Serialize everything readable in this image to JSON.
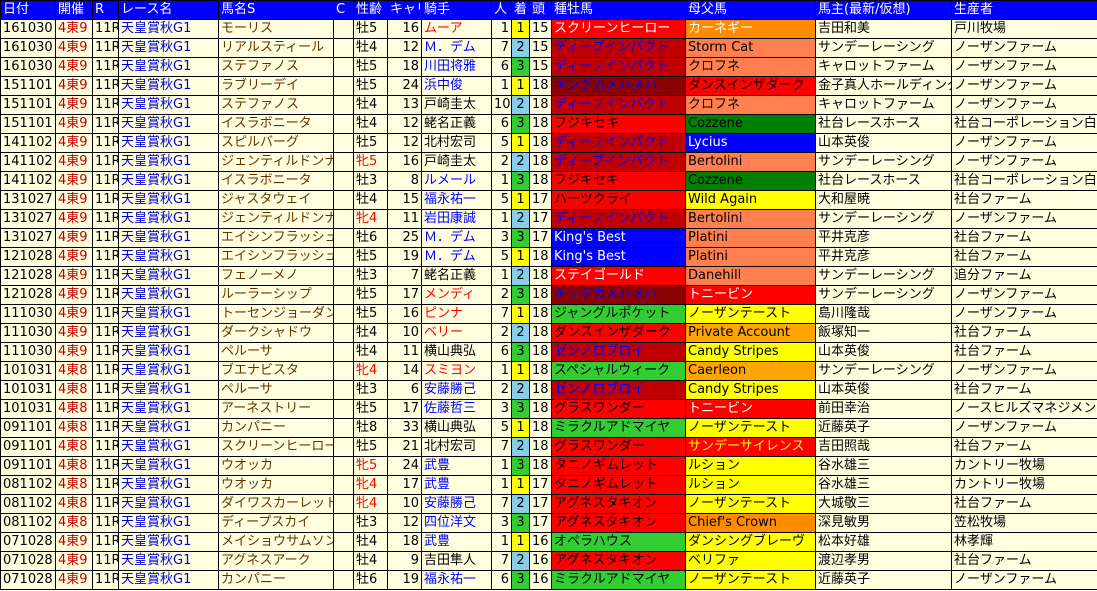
{
  "headers": [
    "日付",
    "開催",
    "R",
    "レース名",
    "馬名S",
    "C",
    "性齢",
    "キャリア",
    "騎手",
    "人",
    "着",
    "頭",
    "種牡馬",
    "母父馬",
    "馬主(最新/仮想)",
    "生産者"
  ],
  "rows": [
    {
      "date": "161030",
      "venue": "4東9",
      "r": "11R",
      "race": "天皇賞秋G1",
      "horse": "モーリス",
      "c": "",
      "sexage": "牡5",
      "sex_red": false,
      "career": "16",
      "jockey": "ムーア",
      "jockey_color": "#ff0000",
      "pop": "1",
      "fin": "1",
      "heads": "15",
      "sire": "スクリーンヒーロー",
      "sire_bg": "#ff0000",
      "sire_fg": "#ffffff",
      "dam": "カーネギー",
      "dam_bg": "#ff8c00",
      "dam_fg": "#ffffff",
      "owner": "吉田和美",
      "breeder": "戸川牧場"
    },
    {
      "date": "161030",
      "venue": "4東9",
      "r": "11R",
      "race": "天皇賞秋G1",
      "horse": "リアルスティール",
      "c": "",
      "sexage": "牡4",
      "sex_red": false,
      "career": "12",
      "jockey": "Ｍ．デム",
      "jockey_color": "#0000ff",
      "pop": "7",
      "fin": "2",
      "heads": "15",
      "sire": "ディープインパクト",
      "sire_bg": "#c00000",
      "sire_fg": "#0000ff",
      "dam": "Storm Cat",
      "dam_bg": "#ff7f50",
      "dam_fg": "#000000",
      "owner": "サンデーレーシング",
      "breeder": "ノーザンファーム"
    },
    {
      "date": "161030",
      "venue": "4東9",
      "r": "11R",
      "race": "天皇賞秋G1",
      "horse": "ステファノス",
      "c": "",
      "sexage": "牡5",
      "sex_red": false,
      "career": "18",
      "jockey": "川田将雅",
      "jockey_color": "#0000ff",
      "pop": "6",
      "fin": "3",
      "heads": "15",
      "sire": "ディープインパクト",
      "sire_bg": "#c00000",
      "sire_fg": "#0000ff",
      "dam": "クロフネ",
      "dam_bg": "#ff7f50",
      "dam_fg": "#000000",
      "owner": "キャロットファーム",
      "breeder": "ノーザンファーム"
    },
    {
      "date": "151101",
      "venue": "4東9",
      "r": "11R",
      "race": "天皇賞秋G1",
      "horse": "ラブリーデイ",
      "c": "",
      "sexage": "牡5",
      "sex_red": false,
      "career": "24",
      "jockey": "浜中俊",
      "jockey_color": "#0000ff",
      "pop": "1",
      "fin": "1",
      "heads": "18",
      "sire": "キングカメハメハ",
      "sire_bg": "#8b0000",
      "sire_fg": "#0000ff",
      "dam": "ダンスインザダーク",
      "dam_bg": "#ff0000",
      "dam_fg": "#000000",
      "owner": "金子真人ホールディングス",
      "breeder": "ノーザンファーム"
    },
    {
      "date": "151101",
      "venue": "4東9",
      "r": "11R",
      "race": "天皇賞秋G1",
      "horse": "ステファノス",
      "c": "",
      "sexage": "牡4",
      "sex_red": false,
      "career": "13",
      "jockey": "戸崎圭太",
      "jockey_color": "#000000",
      "pop": "10",
      "fin": "2",
      "heads": "18",
      "sire": "ディープインパクト",
      "sire_bg": "#c00000",
      "sire_fg": "#0000ff",
      "dam": "クロフネ",
      "dam_bg": "#ff7f50",
      "dam_fg": "#000000",
      "owner": "キャロットファーム",
      "breeder": "ノーザンファーム"
    },
    {
      "date": "151101",
      "venue": "4東9",
      "r": "11R",
      "race": "天皇賞秋G1",
      "horse": "イスラボニータ",
      "c": "",
      "sexage": "牡4",
      "sex_red": false,
      "career": "12",
      "jockey": "蛯名正義",
      "jockey_color": "#000000",
      "pop": "6",
      "fin": "3",
      "heads": "18",
      "sire": "フジキセキ",
      "sire_bg": "#ff0000",
      "sire_fg": "#000000",
      "dam": "Cozzene",
      "dam_bg": "#008000",
      "dam_fg": "#000000",
      "owner": "社台レースホース",
      "breeder": "社台コーポレーション白老ファーム"
    },
    {
      "date": "141102",
      "venue": "4東9",
      "r": "11R",
      "race": "天皇賞秋G1",
      "horse": "スピルバーグ",
      "c": "",
      "sexage": "牡5",
      "sex_red": false,
      "career": "12",
      "jockey": "北村宏司",
      "jockey_color": "#000000",
      "pop": "5",
      "fin": "1",
      "heads": "18",
      "sire": "ディープインパクト",
      "sire_bg": "#c00000",
      "sire_fg": "#0000ff",
      "dam": "Lycius",
      "dam_bg": "#0000ff",
      "dam_fg": "#ffffff",
      "owner": "山本英俊",
      "breeder": "ノーザンファーム"
    },
    {
      "date": "141102",
      "venue": "4東9",
      "r": "11R",
      "race": "天皇賞秋G1",
      "horse": "ジェンティルドンナ",
      "c": "",
      "sexage": "牝5",
      "sex_red": true,
      "career": "16",
      "jockey": "戸崎圭太",
      "jockey_color": "#000000",
      "pop": "2",
      "fin": "2",
      "heads": "18",
      "sire": "ディープインパクト",
      "sire_bg": "#c00000",
      "sire_fg": "#0000ff",
      "dam": "Bertolini",
      "dam_bg": "#ff7f50",
      "dam_fg": "#000000",
      "owner": "サンデーレーシング",
      "breeder": "ノーザンファーム"
    },
    {
      "date": "141102",
      "venue": "4東9",
      "r": "11R",
      "race": "天皇賞秋G1",
      "horse": "イスラボニータ",
      "c": "",
      "sexage": "牡3",
      "sex_red": false,
      "career": "8",
      "jockey": "ルメール",
      "jockey_color": "#0000ff",
      "pop": "1",
      "fin": "3",
      "heads": "18",
      "sire": "フジキセキ",
      "sire_bg": "#ff0000",
      "sire_fg": "#000000",
      "dam": "Cozzene",
      "dam_bg": "#008000",
      "dam_fg": "#000000",
      "owner": "社台レースホース",
      "breeder": "社台コーポレーション白老ファーム"
    },
    {
      "date": "131027",
      "venue": "4東9",
      "r": "11R",
      "race": "天皇賞秋G1",
      "horse": "ジャスタウェイ",
      "c": "",
      "sexage": "牡4",
      "sex_red": false,
      "career": "15",
      "jockey": "福永祐一",
      "jockey_color": "#0000ff",
      "pop": "5",
      "fin": "1",
      "heads": "17",
      "sire": "ハーツクライ",
      "sire_bg": "#ff0000",
      "sire_fg": "#000000",
      "dam": "Wild Again",
      "dam_bg": "#ffff00",
      "dam_fg": "#000000",
      "owner": "大和屋暁",
      "breeder": "社台ファーム"
    },
    {
      "date": "131027",
      "venue": "4東9",
      "r": "11R",
      "race": "天皇賞秋G1",
      "horse": "ジェンティルドンナ",
      "c": "",
      "sexage": "牝4",
      "sex_red": true,
      "career": "11",
      "jockey": "岩田康誠",
      "jockey_color": "#0000ff",
      "pop": "1",
      "fin": "2",
      "heads": "17",
      "sire": "ディープインパクト",
      "sire_bg": "#c00000",
      "sire_fg": "#0000ff",
      "dam": "Bertolini",
      "dam_bg": "#ff7f50",
      "dam_fg": "#000000",
      "owner": "サンデーレーシング",
      "breeder": "ノーザンファーム"
    },
    {
      "date": "131027",
      "venue": "4東9",
      "r": "11R",
      "race": "天皇賞秋G1",
      "horse": "エイシンフラッシュ",
      "c": "",
      "sexage": "牡6",
      "sex_red": false,
      "career": "25",
      "jockey": "Ｍ．デム",
      "jockey_color": "#0000ff",
      "pop": "3",
      "fin": "3",
      "heads": "17",
      "sire": "King's Best",
      "sire_bg": "#0000ff",
      "sire_fg": "#ffffff",
      "dam": "Platini",
      "dam_bg": "#ff7f50",
      "dam_fg": "#000000",
      "owner": "平井克彦",
      "breeder": "社台ファーム"
    },
    {
      "date": "121028",
      "venue": "4東9",
      "r": "11R",
      "race": "天皇賞秋G1",
      "horse": "エイシンフラッシュ",
      "c": "",
      "sexage": "牡5",
      "sex_red": false,
      "career": "19",
      "jockey": "Ｍ．デム",
      "jockey_color": "#0000ff",
      "pop": "5",
      "fin": "1",
      "heads": "18",
      "sire": "King's Best",
      "sire_bg": "#0000ff",
      "sire_fg": "#ffffff",
      "dam": "Platini",
      "dam_bg": "#ff7f50",
      "dam_fg": "#000000",
      "owner": "平井克彦",
      "breeder": "社台ファーム"
    },
    {
      "date": "121028",
      "venue": "4東9",
      "r": "11R",
      "race": "天皇賞秋G1",
      "horse": "フェノーメノ",
      "c": "",
      "sexage": "牡3",
      "sex_red": false,
      "career": "7",
      "jockey": "蛯名正義",
      "jockey_color": "#000000",
      "pop": "1",
      "fin": "2",
      "heads": "18",
      "sire": "ステイゴールド",
      "sire_bg": "#ff0000",
      "sire_fg": "#ffffff",
      "dam": "Danehill",
      "dam_bg": "#ff7f50",
      "dam_fg": "#000000",
      "owner": "サンデーレーシング",
      "breeder": "追分ファーム"
    },
    {
      "date": "121028",
      "venue": "4東9",
      "r": "11R",
      "race": "天皇賞秋G1",
      "horse": "ルーラーシップ",
      "c": "",
      "sexage": "牡5",
      "sex_red": false,
      "career": "17",
      "jockey": "メンディ",
      "jockey_color": "#ff0000",
      "pop": "2",
      "fin": "3",
      "heads": "18",
      "sire": "キングカメハメハ",
      "sire_bg": "#8b0000",
      "sire_fg": "#0000ff",
      "dam": "トニービン",
      "dam_bg": "#ff0000",
      "dam_fg": "#ffffff",
      "owner": "サンデーレーシング",
      "breeder": "ノーザンファーム"
    },
    {
      "date": "111030",
      "venue": "4東9",
      "r": "11R",
      "race": "天皇賞秋G1",
      "horse": "トーセンジョーダン",
      "c": "",
      "sexage": "牡5",
      "sex_red": false,
      "career": "16",
      "jockey": "ピンナ",
      "jockey_color": "#ff0000",
      "pop": "7",
      "fin": "1",
      "heads": "18",
      "sire": "ジャングルポケット",
      "sire_bg": "#32cd32",
      "sire_fg": "#000000",
      "dam": "ノーザンテースト",
      "dam_bg": "#ffff00",
      "dam_fg": "#000000",
      "owner": "島川隆哉",
      "breeder": "ノーザンファーム"
    },
    {
      "date": "111030",
      "venue": "4東9",
      "r": "11R",
      "race": "天皇賞秋G1",
      "horse": "ダークシャドウ",
      "c": "",
      "sexage": "牡4",
      "sex_red": false,
      "career": "10",
      "jockey": "ベリー",
      "jockey_color": "#ff0000",
      "pop": "2",
      "fin": "2",
      "heads": "18",
      "sire": "ダンスインザダーク",
      "sire_bg": "#ff0000",
      "sire_fg": "#000000",
      "dam": "Private Account",
      "dam_bg": "#ffa500",
      "dam_fg": "#000000",
      "owner": "飯塚知一",
      "breeder": "社台ファーム"
    },
    {
      "date": "111030",
      "venue": "4東9",
      "r": "11R",
      "race": "天皇賞秋G1",
      "horse": "ペルーサ",
      "c": "",
      "sexage": "牡4",
      "sex_red": false,
      "career": "11",
      "jockey": "横山典弘",
      "jockey_color": "#000000",
      "pop": "6",
      "fin": "3",
      "heads": "18",
      "sire": "ゼンノロブロイ",
      "sire_bg": "#c00000",
      "sire_fg": "#0000ff",
      "dam": "Candy Stripes",
      "dam_bg": "#ffff00",
      "dam_fg": "#000000",
      "owner": "山本英俊",
      "breeder": "社台ファーム"
    },
    {
      "date": "101031",
      "venue": "4東8",
      "r": "11R",
      "race": "天皇賞秋G1",
      "horse": "ブエナビスタ",
      "c": "",
      "sexage": "牝4",
      "sex_red": true,
      "career": "14",
      "jockey": "スミヨン",
      "jockey_color": "#ff0000",
      "pop": "1",
      "fin": "1",
      "heads": "18",
      "sire": "スペシャルウィーク",
      "sire_bg": "#32cd32",
      "sire_fg": "#000000",
      "dam": "Caerleon",
      "dam_bg": "#ffa500",
      "dam_fg": "#000000",
      "owner": "サンデーレーシング",
      "breeder": "ノーザンファーム"
    },
    {
      "date": "101031",
      "venue": "4東8",
      "r": "11R",
      "race": "天皇賞秋G1",
      "horse": "ペルーサ",
      "c": "",
      "sexage": "牡3",
      "sex_red": false,
      "career": "6",
      "jockey": "安藤勝己",
      "jockey_color": "#0000ff",
      "pop": "2",
      "fin": "2",
      "heads": "18",
      "sire": "ゼンノロブロイ",
      "sire_bg": "#c00000",
      "sire_fg": "#0000ff",
      "dam": "Candy Stripes",
      "dam_bg": "#ffff00",
      "dam_fg": "#000000",
      "owner": "山本英俊",
      "breeder": "社台ファーム"
    },
    {
      "date": "101031",
      "venue": "4東8",
      "r": "11R",
      "race": "天皇賞秋G1",
      "horse": "アーネストリー",
      "c": "",
      "sexage": "牡5",
      "sex_red": false,
      "career": "17",
      "jockey": "佐藤哲三",
      "jockey_color": "#0000ff",
      "pop": "3",
      "fin": "3",
      "heads": "18",
      "sire": "グラスワンダー",
      "sire_bg": "#ff0000",
      "sire_fg": "#000000",
      "dam": "トニービン",
      "dam_bg": "#ff0000",
      "dam_fg": "#ffffff",
      "owner": "前田幸治",
      "breeder": "ノースヒルズマネジメント"
    },
    {
      "date": "091101",
      "venue": "4東8",
      "r": "11R",
      "race": "天皇賞秋G1",
      "horse": "カンパニー",
      "c": "",
      "sexage": "牡8",
      "sex_red": false,
      "career": "33",
      "jockey": "横山典弘",
      "jockey_color": "#000000",
      "pop": "5",
      "fin": "1",
      "heads": "18",
      "sire": "ミラクルアドマイヤ",
      "sire_bg": "#32cd32",
      "sire_fg": "#000000",
      "dam": "ノーザンテースト",
      "dam_bg": "#ffff00",
      "dam_fg": "#000000",
      "owner": "近藤英子",
      "breeder": "ノーザンファーム"
    },
    {
      "date": "091101",
      "venue": "4東8",
      "r": "11R",
      "race": "天皇賞秋G1",
      "horse": "スクリーンヒーロー",
      "c": "",
      "sexage": "牡5",
      "sex_red": false,
      "career": "21",
      "jockey": "北村宏司",
      "jockey_color": "#000000",
      "pop": "7",
      "fin": "2",
      "heads": "18",
      "sire": "グラスワンダー",
      "sire_bg": "#ff0000",
      "sire_fg": "#000000",
      "dam": "サンデーサイレンス",
      "dam_bg": "#ff0000",
      "dam_fg": "#ffff00",
      "owner": "吉田照哉",
      "breeder": "社台ファーム"
    },
    {
      "date": "091101",
      "venue": "4東8",
      "r": "11R",
      "race": "天皇賞秋G1",
      "horse": "ウオッカ",
      "c": "",
      "sexage": "牝5",
      "sex_red": true,
      "career": "24",
      "jockey": "武豊",
      "jockey_color": "#0000ff",
      "pop": "1",
      "fin": "3",
      "heads": "18",
      "sire": "タニノギムレット",
      "sire_bg": "#ff0000",
      "sire_fg": "#000000",
      "dam": "ルション",
      "dam_bg": "#ffff00",
      "dam_fg": "#000000",
      "owner": "谷水雄三",
      "breeder": "カントリー牧場"
    },
    {
      "date": "081102",
      "venue": "4東8",
      "r": "11R",
      "race": "天皇賞秋G1",
      "horse": "ウオッカ",
      "c": "",
      "sexage": "牝4",
      "sex_red": true,
      "career": "17",
      "jockey": "武豊",
      "jockey_color": "#0000ff",
      "pop": "1",
      "fin": "1",
      "heads": "17",
      "sire": "タニノギムレット",
      "sire_bg": "#ff0000",
      "sire_fg": "#000000",
      "dam": "ルション",
      "dam_bg": "#ffff00",
      "dam_fg": "#000000",
      "owner": "谷水雄三",
      "breeder": "カントリー牧場"
    },
    {
      "date": "081102",
      "venue": "4東8",
      "r": "11R",
      "race": "天皇賞秋G1",
      "horse": "ダイワスカーレット",
      "c": "",
      "sexage": "牝4",
      "sex_red": true,
      "career": "10",
      "jockey": "安藤勝己",
      "jockey_color": "#0000ff",
      "pop": "7",
      "fin": "2",
      "heads": "17",
      "sire": "アグネスタキオン",
      "sire_bg": "#ff0000",
      "sire_fg": "#000000",
      "dam": "ノーザンテースト",
      "dam_bg": "#ffff00",
      "dam_fg": "#000000",
      "owner": "大城敬三",
      "breeder": "社台ファーム"
    },
    {
      "date": "081102",
      "venue": "4東8",
      "r": "11R",
      "race": "天皇賞秋G1",
      "horse": "ディープスカイ",
      "c": "",
      "sexage": "牡3",
      "sex_red": false,
      "career": "12",
      "jockey": "四位洋文",
      "jockey_color": "#0000ff",
      "pop": "3",
      "fin": "3",
      "heads": "17",
      "sire": "アグネスタキオン",
      "sire_bg": "#ff0000",
      "sire_fg": "#000000",
      "dam": "Chief's Crown",
      "dam_bg": "#ff8c00",
      "dam_fg": "#000000",
      "owner": "深見敏男",
      "breeder": "笠松牧場"
    },
    {
      "date": "071028",
      "venue": "4東9",
      "r": "11R",
      "race": "天皇賞秋G1",
      "horse": "メイショウサムソン",
      "c": "",
      "sexage": "牡4",
      "sex_red": false,
      "career": "18",
      "jockey": "武豊",
      "jockey_color": "#0000ff",
      "pop": "1",
      "fin": "1",
      "heads": "16",
      "sire": "オペラハウス",
      "sire_bg": "#32cd32",
      "sire_fg": "#000000",
      "dam": "ダンシングブレーヴ",
      "dam_bg": "#ffff00",
      "dam_fg": "#000000",
      "owner": "松本好雄",
      "breeder": "林孝輝"
    },
    {
      "date": "071028",
      "venue": "4東9",
      "r": "11R",
      "race": "天皇賞秋G1",
      "horse": "アグネスアーク",
      "c": "",
      "sexage": "牡4",
      "sex_red": false,
      "career": "9",
      "jockey": "吉田隼人",
      "jockey_color": "#000000",
      "pop": "7",
      "fin": "2",
      "heads": "16",
      "sire": "アグネスタキオン",
      "sire_bg": "#ff0000",
      "sire_fg": "#000000",
      "dam": "ベリファ",
      "dam_bg": "#ffff00",
      "dam_fg": "#000000",
      "owner": "渡辺孝男",
      "breeder": "社台ファーム"
    },
    {
      "date": "071028",
      "venue": "4東9",
      "r": "11R",
      "race": "天皇賞秋G1",
      "horse": "カンパニー",
      "c": "",
      "sexage": "牡6",
      "sex_red": false,
      "career": "19",
      "jockey": "福永祐一",
      "jockey_color": "#0000ff",
      "pop": "6",
      "fin": "3",
      "heads": "16",
      "sire": "ミラクルアドマイヤ",
      "sire_bg": "#32cd32",
      "sire_fg": "#000000",
      "dam": "ノーザンテースト",
      "dam_bg": "#ffff00",
      "dam_fg": "#000000",
      "owner": "近藤英子",
      "breeder": "ノーザンファーム"
    }
  ]
}
